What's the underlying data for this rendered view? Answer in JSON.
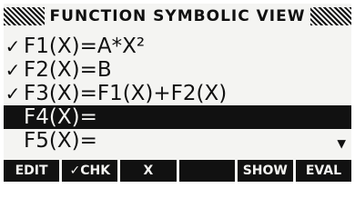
{
  "header": {
    "title": "FUNCTION SYMBOLIC VIEW"
  },
  "functions": [
    {
      "checked": true,
      "check_mark": "✓",
      "expr": "F1(X)=A*X²",
      "selected": false
    },
    {
      "checked": true,
      "check_mark": "✓",
      "expr": "F2(X)=B",
      "selected": false
    },
    {
      "checked": true,
      "check_mark": "✓",
      "expr": "F3(X)=F1(X)+F2(X)",
      "selected": false
    },
    {
      "checked": false,
      "check_mark": "",
      "expr": "F4(X)=",
      "selected": true
    },
    {
      "checked": false,
      "check_mark": "",
      "expr": "F5(X)=",
      "selected": false
    }
  ],
  "scroll_indicator": "▼",
  "menu": {
    "keys": [
      "EDIT",
      "✓CHK",
      "X",
      "",
      "SHOW",
      "EVAL"
    ]
  }
}
